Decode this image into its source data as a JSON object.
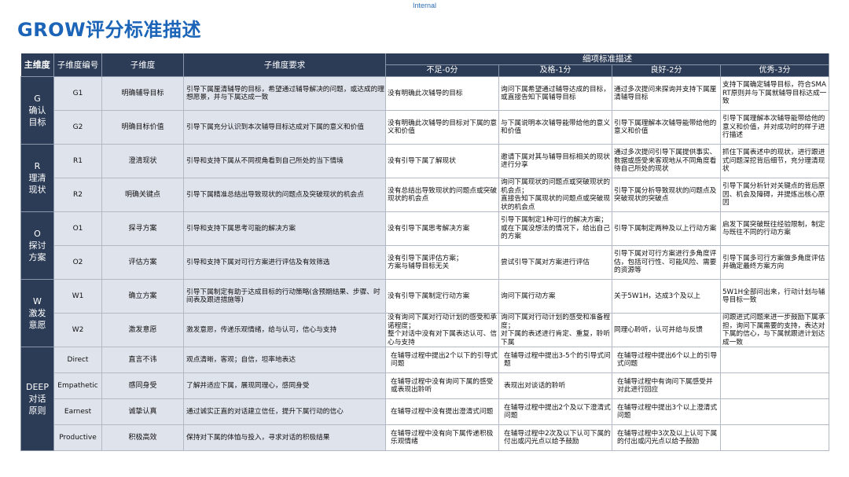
{
  "header": {
    "classification": "Internal",
    "title": "GROW评分标准描述"
  },
  "table": {
    "col_dimension": "主维度",
    "col_sub_code": "子维度编号",
    "col_sub_name": "子维度",
    "col_requirement": "子维度要求",
    "group_header": "细项标准描述",
    "levels": [
      "不足-0分",
      "及格-1分",
      "良好-2分",
      "优秀-3分"
    ],
    "groups": [
      {
        "dimension": "G\n确认\n目标",
        "rows": [
          {
            "code": "G1",
            "name": "明确辅导目标",
            "requirement": "引导下属厘清辅导的目标，希望通过辅导解决的问题，或达成的理想愿景，并与下属达成一致",
            "c0": "没有明确此次辅导的目标",
            "c1": "询问下属希望通过辅导达成的目标，或直接告知下属辅导目标",
            "c2": "通过多次提问来探询并支持下属厘清辅导目标",
            "c3": "支持下属确定辅导目标，符合SMART原则并与下属就辅导目标达成一致"
          },
          {
            "code": "G2",
            "name": "明确目标价值",
            "requirement": "引导下属充分认识到本次辅导目标达成对下属的意义和价值",
            "c0": "没有明确此次辅导的目标对下属的意义和价值",
            "c1": "与下属说明本次辅导能带给他的意义和价值",
            "c2": "引导下属理解本次辅导能带给他的意义和价值",
            "c3": "引导下属理解本次辅导能带给他的意义和价值，并对成功时的样子进行描述"
          }
        ]
      },
      {
        "dimension": "R\n理清\n现状",
        "rows": [
          {
            "code": "R1",
            "name": "澄清现状",
            "requirement": "引导和支持下属从不同视角看到自己所处的当下情境",
            "c0": "没有引导下属了解现状",
            "c1": "邀请下属对其与辅导目标相关的现状进行分享",
            "c2": "通过多次提问引导下属提供事实、数据或感受来客观地从不同角度看待自己所处的现状",
            "c3": "抓住下属表述中的现状，进行跟进式问题深挖背后细节，充分理清现状"
          },
          {
            "code": "R2",
            "name": "明确关键点",
            "requirement": "引导下属精准总结出导致现状的问题点及突破现状的机会点",
            "c0": "没有总结出导致现状的问题点或突破现状的机会点",
            "c1": "询问下属现状的问题点或突破现状的机会点；\n直接告知下属现状的问题点或突破现状的机会点",
            "c2": "引导下属分析导致现状的问题点及突破现状的突破点",
            "c3": "引导下属分析针对关键点的背后原因、机会及障碍，并提炼出核心原因"
          }
        ]
      },
      {
        "dimension": "O\n探讨\n方案",
        "rows": [
          {
            "code": "O1",
            "name": "探寻方案",
            "requirement": "引导和支持下属思考可能的解决方案",
            "c0": "没有引导下属思考解决方案",
            "c1": "引导下属制定1种可行的解决方案；\n或在下属没想法的情况下，给出自己的方案",
            "c2": "引导下属制定两种及以上行动方案",
            "c3": "启发下属突破既往经验限制，制定与既往不同的行动方案"
          },
          {
            "code": "O2",
            "name": "评估方案",
            "requirement": "引导和支持下属对可行方案进行评估及有效筛选",
            "c0": "没有引导下属评估方案；\n方案与辅导目标无关",
            "c1": "尝试引导下属对方案进行评估",
            "c2": "引导下属对可行方案进行多角度评估，包括可行性、可能风险、需要的资源等",
            "c3": "引导下属多可行方案做多角度评估并确定最终方案方向"
          }
        ]
      },
      {
        "dimension": "W\n激发\n意愿",
        "rows": [
          {
            "code": "W1",
            "name": "确立方案",
            "requirement": "引导下属制定有助于达成目标的行动策略(含预期结果、步骤、时间表及跟进措施等)",
            "c0": "没有引导下属制定行动方案",
            "c1": "询问下属行动方案",
            "c2": "关于5W1H，达成3个及以上",
            "c3": "5W1H全部问出来，行动计划与辅导目标一致"
          },
          {
            "code": "W2",
            "name": "激发意愿",
            "requirement": "激发意愿，传递乐观情绪，给与认可，信心与支持",
            "c0": "没有询问下属对行动计划的感受和承诺程度；\n整个对话中没有对下属表达认可、信心与支持",
            "c1": "询问下属对行动计划的感受和准备程度；\n对下属的表述进行肯定、重复，聆听下属",
            "c2": "同理心聆听，认可并给与反馈",
            "c3": "问跟进式问题来进一步鼓励下属承担，询问下属需要的支持，表达对下属的信心，与下属就跟进计划达成一致"
          }
        ]
      },
      {
        "dimension": "DEEP\n对话\n原则",
        "rows": [
          {
            "code": "Direct",
            "name": "直言不讳",
            "requirement": "观点清晰，客观；自信，坦率地表达",
            "c0": "在辅导过程中提出2个以下的引导式问题",
            "c1": "在辅导过程中提出3-5个的引导式问题",
            "c2": "在辅导过程中提出6个以上的引导式问题",
            "c3": ""
          },
          {
            "code": "Empathetic",
            "name": "感同身受",
            "requirement": "了解并适应下属，展现同理心，感同身受",
            "c0": "在辅导过程中没有询问下属的感受或表现出聆听",
            "c1": "表现出对谈话的聆听",
            "c2": "在辅导过程中有询问下属感受并对此进行回应",
            "c3": ""
          },
          {
            "code": "Earnest",
            "name": "诚挚认真",
            "requirement": "通过诚实正直的对话建立信任，提升下属行动的信心",
            "c0": "在辅导过程中没有提出澄清式问题",
            "c1": "在辅导过程中提出2个及以下澄清式问题",
            "c2": "在辅导过程中提出3个以上澄清式问题",
            "c3": ""
          },
          {
            "code": "Productive",
            "name": "积极高效",
            "requirement": "保持对下属的体恤与投入，寻求对话的积极结果",
            "c0": "在辅导过程中没有向下属传递积极乐观情绪",
            "c1": "在辅导过程中2次及以下认可下属的付出或闪光点以给予鼓励",
            "c2": "在辅导过程中3次及以上认可下属的付出或闪光点以给予鼓励",
            "c3": ""
          }
        ]
      }
    ]
  }
}
